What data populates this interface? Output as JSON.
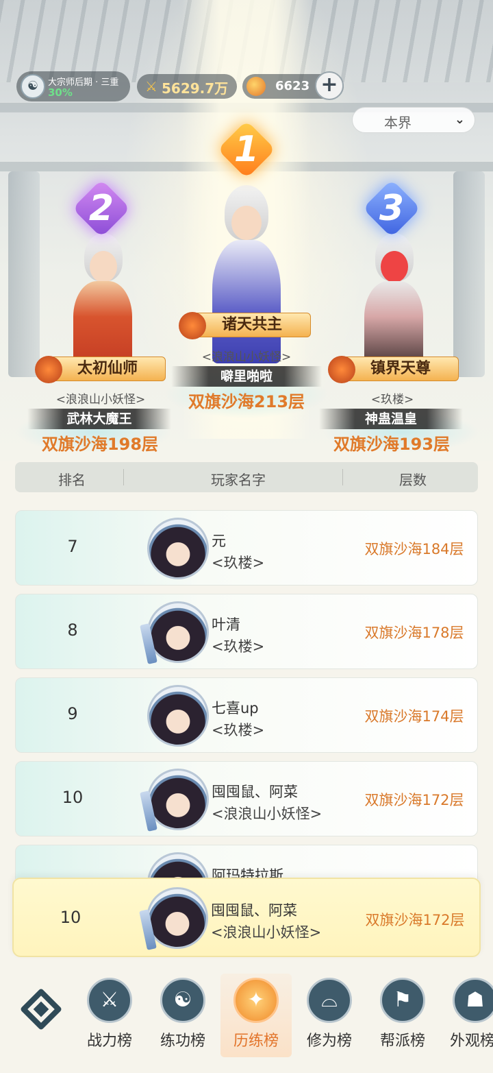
{
  "status": {
    "realm_name": "大宗师后期 · 三重",
    "realm_progress": "30%",
    "power": "5629.7万",
    "currency": "6623",
    "add_label": "+"
  },
  "scope": {
    "selected": "本界"
  },
  "podium": [
    {
      "rank": "1",
      "title": "诸天共主",
      "guild": "<浪浪山小妖怪>",
      "name": "噼里啪啦",
      "floor": "双旗沙海213层"
    },
    {
      "rank": "2",
      "title": "太初仙师",
      "guild": "<浪浪山小妖怪>",
      "name": "武林大魔王",
      "floor": "双旗沙海198层"
    },
    {
      "rank": "3",
      "title": "镇界天尊",
      "guild": "<玖楼>",
      "name": "神蛊温皇",
      "floor": "双旗沙海193层"
    }
  ],
  "table": {
    "headers": {
      "rank": "排名",
      "name": "玩家名字",
      "floor": "层数"
    },
    "rows": [
      {
        "rank": "7",
        "name": "元",
        "guild": "<玖楼>",
        "floor": "双旗沙海184层"
      },
      {
        "rank": "8",
        "name": "叶清",
        "guild": "<玖楼>",
        "floor": "双旗沙海178层"
      },
      {
        "rank": "9",
        "name": "七喜up",
        "guild": "<玖楼>",
        "floor": "双旗沙海174层"
      },
      {
        "rank": "10",
        "name": "囤囤鼠、阿菜",
        "guild": "<浪浪山小妖怪>",
        "floor": "双旗沙海172层"
      },
      {
        "rank": "",
        "name": "阿玛特拉斯",
        "guild": "",
        "floor": ""
      }
    ]
  },
  "my_rank": {
    "rank": "10",
    "name": "囤囤鼠、阿菜",
    "guild": "<浪浪山小妖怪>",
    "floor": "双旗沙海172层"
  },
  "nav": [
    {
      "label": "战力榜",
      "icon": "crossed-swords-icon"
    },
    {
      "label": "练功榜",
      "icon": "yin-yang-icon"
    },
    {
      "label": "历练榜",
      "icon": "star-burst-icon"
    },
    {
      "label": "修为榜",
      "icon": "scholar-hat-icon"
    },
    {
      "label": "帮派榜",
      "icon": "banner-icon"
    },
    {
      "label": "外观榜",
      "icon": "mask-icon"
    }
  ],
  "colors": {
    "accent": "#e2742a",
    "floor_text": "#d9792a",
    "nav_icon": "#3f5b6b"
  }
}
